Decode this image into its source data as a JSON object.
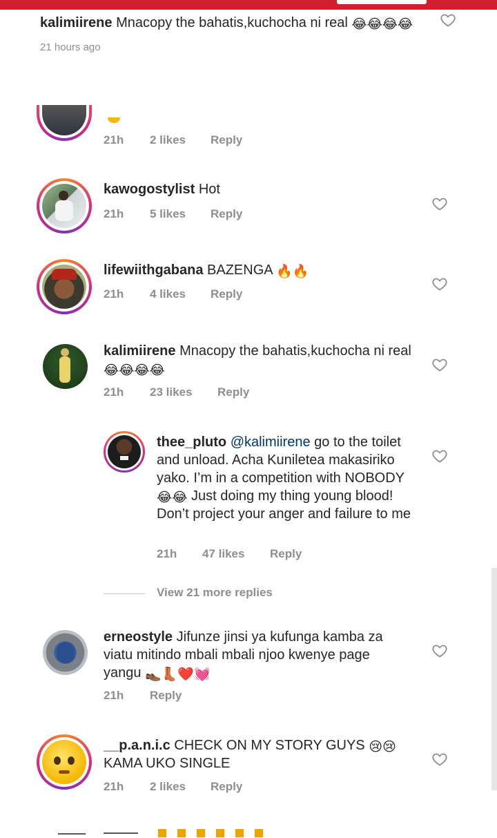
{
  "colors": {
    "accent": "#d0202b",
    "muted": "#8e8e8e",
    "text": "#262626"
  },
  "pinned": {
    "username": "kalimiirene",
    "text": "Mnacopy the bahatis,kuchocha ni real",
    "emojis": "😂😂😂😂",
    "time": "21 hours ago"
  },
  "partial": {
    "time": "21h",
    "likes": "2 likes",
    "reply": "Reply"
  },
  "comments": [
    {
      "username": "kawogostylist",
      "text": "Hot",
      "time": "21h",
      "likes": "5 likes",
      "reply": "Reply"
    },
    {
      "username": "lifewiithgabana",
      "text": "BAZENGA",
      "emojis": "🔥🔥",
      "time": "21h",
      "likes": "4 likes",
      "reply": "Reply"
    },
    {
      "username": "kalimiirene",
      "text": "Mnacopy the bahatis,kuchocha ni real",
      "emojis": "😂😂😂😂",
      "time": "21h",
      "likes": "23 likes",
      "reply": "Reply"
    },
    {
      "username": "thee_pluto",
      "mention": "@kalimiirene",
      "text": "go to the toilet and unload. Acha Kuniletea makasiriko yako. I’m in a competition with NOBODY",
      "emojis": "😂😂",
      "text2": "Just doing my thing young blood! Don’t project your anger and failure to me",
      "time": "21h",
      "likes": "47 likes",
      "reply": "Reply"
    },
    {
      "username": "erneostyle",
      "text": "Jifunze jinsi ya kufunga kamba za viatu mitindo mbali mbali njoo kwenye page yangu",
      "emojis": "👞👢❤️💓",
      "time": "21h",
      "reply": "Reply"
    },
    {
      "username": "__p.a.n.i.c",
      "text": "CHECK ON MY STORY GUYS",
      "emojis": "😢😢",
      "text2": "KAMA UKO SINGLE",
      "time": "21h",
      "likes": "2 likes",
      "reply": "Reply"
    }
  ],
  "view_more": "View 21 more replies"
}
